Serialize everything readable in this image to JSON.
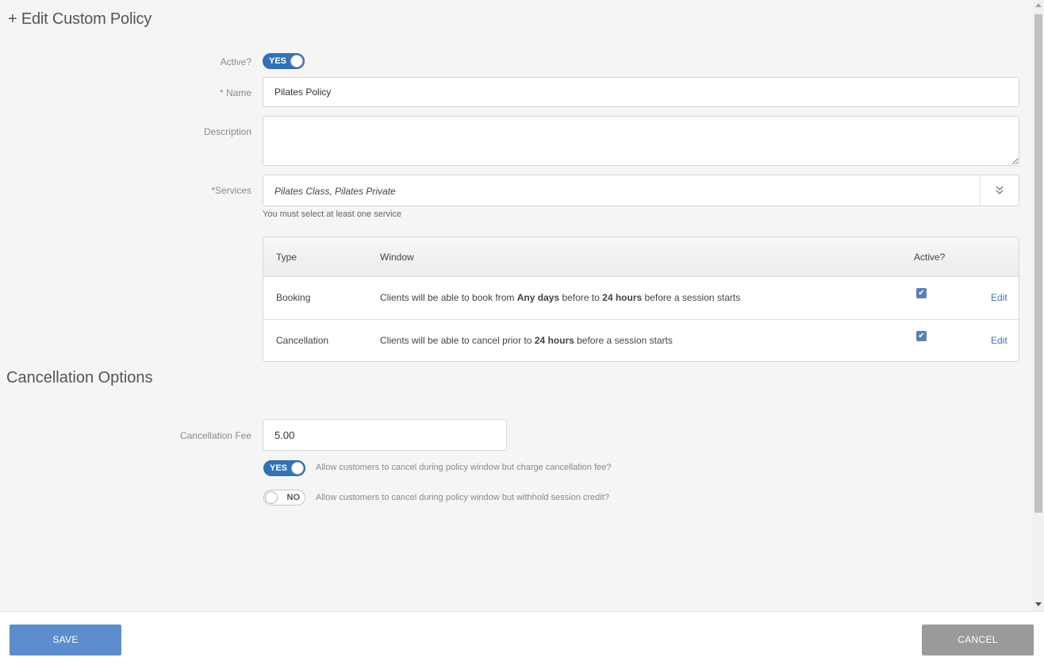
{
  "header": {
    "title": "+ Edit Custom Policy"
  },
  "form": {
    "active_label": "Active?",
    "active_toggle": "YES",
    "name_label": "* Name",
    "name_value": "Pilates Policy",
    "description_label": "Description",
    "description_value": "",
    "services_label": "*Services",
    "services_value": "Pilates Class, Pilates Private",
    "services_hint": "You must select at least one service",
    "services_dropdown_icon": "chevron-double-down-icon"
  },
  "table": {
    "headers": {
      "type": "Type",
      "window": "Window",
      "active": "Active?"
    },
    "rows": [
      {
        "type": "Booking",
        "window_parts": [
          "Clients will be able to book from ",
          "Any days",
          " before to ",
          "24 hours",
          " before a session starts"
        ],
        "active": true,
        "action": "Edit"
      },
      {
        "type": "Cancellation",
        "window_parts": [
          "Clients will be able to cancel prior to ",
          "24 hours",
          " before a session starts"
        ],
        "active": true,
        "action": "Edit"
      }
    ]
  },
  "cancellation": {
    "section_title": "Cancellation Options",
    "fee_label": "Cancellation Fee",
    "fee_value": "5.00",
    "option1_toggle": "YES",
    "option1_text": "Allow customers to cancel during policy window but charge cancellation fee?",
    "option2_toggle": "NO",
    "option2_text": "Allow customers to cancel during policy window but withhold session credit?"
  },
  "footer": {
    "save_label": "SAVE",
    "cancel_label": "CANCEL"
  },
  "colors": {
    "accent": "#3273b8",
    "save_button": "#5c8dcc",
    "cancel_button": "#9a9a9a",
    "link": "#3f73b8"
  }
}
